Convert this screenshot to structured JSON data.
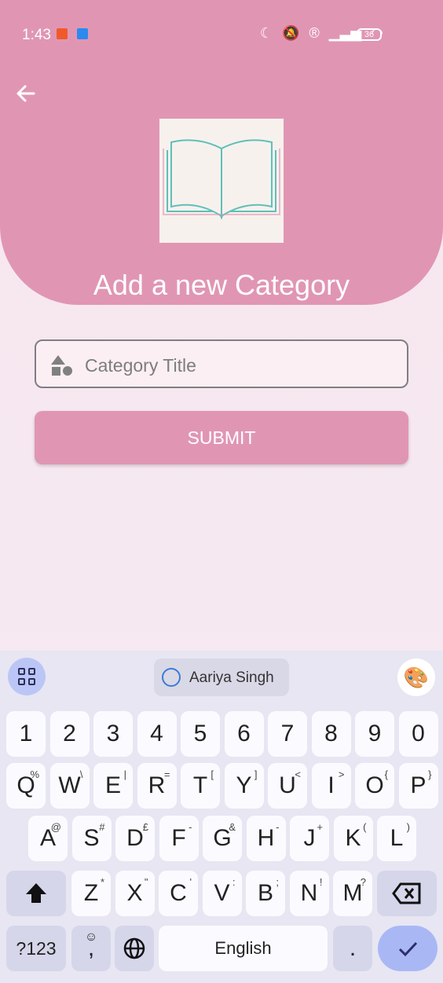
{
  "status_bar": {
    "time": "1:43",
    "battery": "36"
  },
  "header": {
    "title": "Add a new Category"
  },
  "form": {
    "title_placeholder": "Category Title",
    "submit_label": "SUBMIT"
  },
  "keyboard": {
    "suggestion": "Aariya Singh",
    "number_row": [
      "1",
      "2",
      "3",
      "4",
      "5",
      "6",
      "7",
      "8",
      "9",
      "0"
    ],
    "row1": [
      {
        "key": "Q",
        "alt": "%"
      },
      {
        "key": "W",
        "alt": "\\"
      },
      {
        "key": "E",
        "alt": "|"
      },
      {
        "key": "R",
        "alt": "="
      },
      {
        "key": "T",
        "alt": "["
      },
      {
        "key": "Y",
        "alt": "]"
      },
      {
        "key": "U",
        "alt": "<"
      },
      {
        "key": "I",
        "alt": ">"
      },
      {
        "key": "O",
        "alt": "{"
      },
      {
        "key": "P",
        "alt": "}"
      }
    ],
    "row2": [
      {
        "key": "A",
        "alt": "@"
      },
      {
        "key": "S",
        "alt": "#"
      },
      {
        "key": "D",
        "alt": "£"
      },
      {
        "key": "F",
        "alt": "-"
      },
      {
        "key": "G",
        "alt": "&"
      },
      {
        "key": "H",
        "alt": "-"
      },
      {
        "key": "J",
        "alt": "+"
      },
      {
        "key": "K",
        "alt": "("
      },
      {
        "key": "L",
        "alt": ")"
      }
    ],
    "row3": [
      {
        "key": "Z",
        "alt": "*"
      },
      {
        "key": "X",
        "alt": "\""
      },
      {
        "key": "C",
        "alt": "'"
      },
      {
        "key": "V",
        "alt": ":"
      },
      {
        "key": "B",
        "alt": ";"
      },
      {
        "key": "N",
        "alt": "!"
      },
      {
        "key": "M",
        "alt": "?"
      }
    ],
    "symbols_label": "?123",
    "comma_label": ",",
    "space_label": "English",
    "period_label": "."
  },
  "colors": {
    "header": "#e096b3",
    "keyboard_bg": "#e7e6f2",
    "enter_key": "#a9b8f5"
  }
}
